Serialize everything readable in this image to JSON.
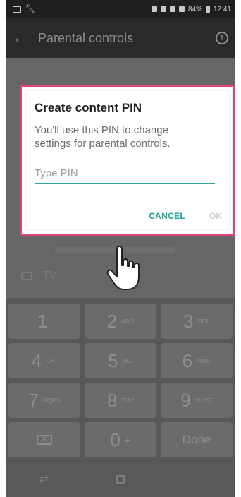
{
  "status_bar": {
    "battery": "84%",
    "time": "12:41"
  },
  "app_bar": {
    "title": "Parental controls",
    "back_icon": "arrow-left-icon",
    "help_icon": "help-circle-icon"
  },
  "background": {
    "tv_label": "TV"
  },
  "dialog": {
    "title": "Create content PIN",
    "message": "You'll use this PIN to change settings for parental controls.",
    "pin_placeholder": "Type PIN",
    "pin_value": "",
    "cancel_label": "CANCEL",
    "ok_label": "OK",
    "accent_color": "#1aa28f",
    "highlight_color": "#e0427a"
  },
  "keypad": {
    "keys": [
      {
        "digit": "1",
        "letters": ""
      },
      {
        "digit": "2",
        "letters": "ABC"
      },
      {
        "digit": "3",
        "letters": "DEF"
      },
      {
        "digit": "4",
        "letters": "GHI"
      },
      {
        "digit": "5",
        "letters": "JKL"
      },
      {
        "digit": "6",
        "letters": "MNO"
      },
      {
        "digit": "7",
        "letters": "PQRS"
      },
      {
        "digit": "8",
        "letters": "TUV"
      },
      {
        "digit": "9",
        "letters": "WXYZ"
      }
    ],
    "zero": {
      "digit": "0",
      "letters": "+"
    },
    "done_label": "Done"
  },
  "nav_bar": {
    "icons": [
      "recent-apps-icon",
      "home-icon",
      "back-icon"
    ]
  }
}
